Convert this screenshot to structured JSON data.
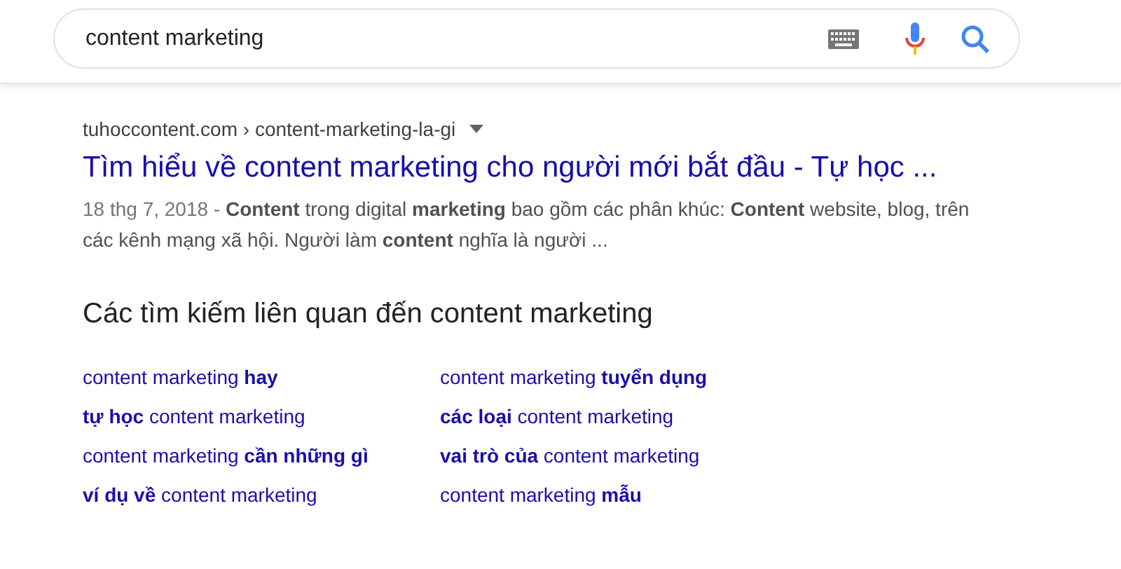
{
  "search": {
    "value": "content marketing"
  },
  "result": {
    "url": "tuhoccontent.com › content-marketing-la-gi",
    "title": "Tìm hiểu về content marketing cho người mới bắt đầu - Tự học ...",
    "date": "18 thg 7, 2018 -",
    "snippet": "**Content** trong digital **marketing** bao gồm các phân khúc: **Content** website, blog, trên các kênh mạng xã hội. Người làm **content** nghĩa là người ..."
  },
  "related": {
    "heading": "Các tìm kiếm liên quan đến content marketing",
    "links": [
      "content marketing **hay**",
      "content marketing **tuyển dụng**",
      "**tự học** content marketing",
      "**các loại** content marketing",
      "content marketing **cần những gì**",
      "**vai trò của** content marketing",
      "**ví dụ về** content marketing",
      "content marketing **mẫu**"
    ]
  }
}
